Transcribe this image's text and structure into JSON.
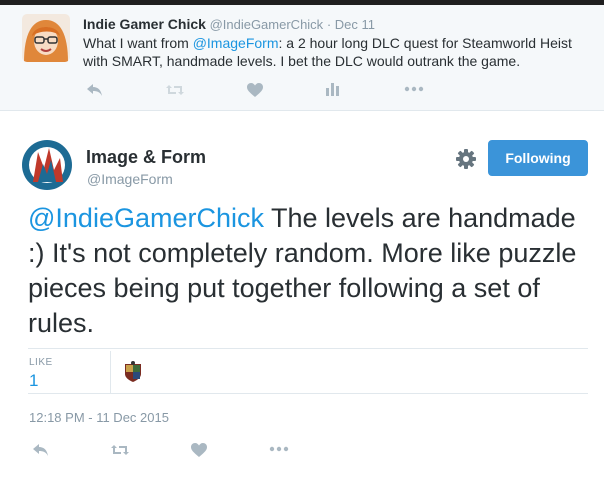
{
  "parent_tweet": {
    "author_name": "Indie Gamer Chick",
    "author_handle": "@IndieGamerChick",
    "separator": "·",
    "date": "Dec 11",
    "text_before": "What I want from ",
    "mention": "@ImageForm",
    "text_after": ": a 2 hour long DLC quest for Steamworld Heist with SMART, handmade levels. I bet the DLC would outrank the game.",
    "actions": [
      "reply-icon",
      "retweet-icon",
      "like-icon",
      "analytics-icon",
      "more-icon"
    ]
  },
  "tweet": {
    "author_name": "Image & Form",
    "author_handle": "@ImageForm",
    "follow_label": "Following",
    "mention": "@IndieGamerChick",
    "text": " The levels are handmade :) It's not completely random. More like puzzle pieces being put together following a set of rules.",
    "stats": {
      "likes_label": "LIKE",
      "likes_count": "1"
    },
    "timestamp": "12:18 PM - 11 Dec 2015",
    "actions": [
      "reply-icon",
      "retweet-icon",
      "like-icon",
      "more-icon"
    ]
  },
  "colors": {
    "accent": "#1b95e0",
    "follow_button": "#3b94d9",
    "muted": "#8899a6",
    "parent_background": "#f5f8fa"
  }
}
